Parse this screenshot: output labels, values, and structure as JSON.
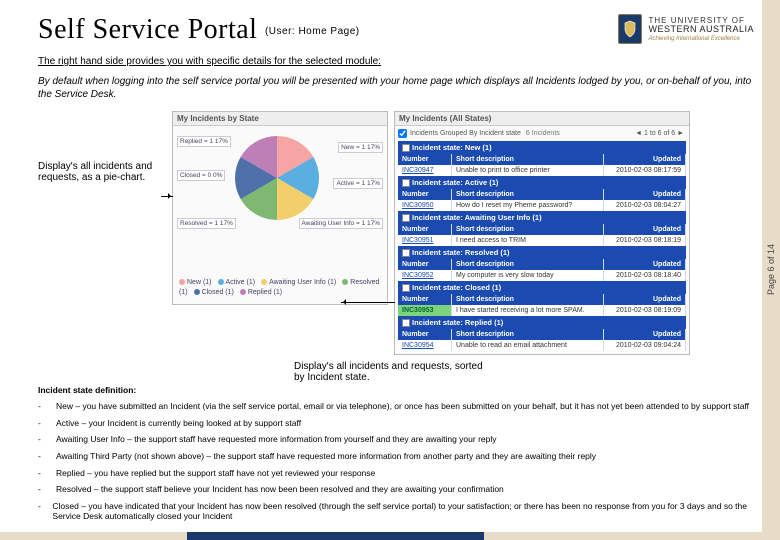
{
  "page_counter": "Page 6 of 14",
  "title_main": "Self Service Portal",
  "title_sub": "(User: Home Page)",
  "uwa": {
    "line1": "THE UNIVERSITY OF",
    "line2": "WESTERN AUSTRALIA",
    "line3": "Achieving International Excellence"
  },
  "intro_underlined": "The right hand side provides you with specific details for the selected module:",
  "intro_italic": "By default when logging into the self service portal you will be presented with your home page which displays all Incidents lodged by you, or on-behalf of you, into the Service Desk.",
  "callout_pie": "Display's all incidents and requests, as a pie-chart.",
  "callout_list": "Display's all incidents and requests, sorted by Incident state.",
  "panel_left_title": "My Incidents by State",
  "panel_right_title": "My Incidents (All States)",
  "grouped_text": "Incidents Grouped By Incident state",
  "grouped_count": "6 Incidents",
  "pager_text": "1 to 6 of 6",
  "col_number": "Number",
  "col_desc": "Short description",
  "col_updated": "Updated",
  "pie": {
    "labels": {
      "replied": "Replied = 1\n17%",
      "closed": "Closed = 0\n0%",
      "resolved": "Resolved = 1\n17%",
      "new": "New = 1 17%",
      "active": "Active = 1 17%",
      "awaiting": "Awaiting User\nInfo = 1 17%"
    },
    "legend": [
      {
        "label": "New (1)",
        "color": "#f6a4a4"
      },
      {
        "label": "Active (1)",
        "color": "#5aaee0"
      },
      {
        "label": "Awaiting User Info (1)",
        "color": "#f3cf6b"
      },
      {
        "label": "Resolved (1)",
        "color": "#7fb971"
      },
      {
        "label": "Closed (1)",
        "color": "#4e6fa7"
      },
      {
        "label": "Replied (1)",
        "color": "#bd7fb5"
      }
    ]
  },
  "states": [
    {
      "state": "Incident state: New (1)",
      "rows": [
        {
          "num": "INC30947",
          "desc": "Unable to print to office printer",
          "upd": "2010-02-03 08:17:59"
        }
      ]
    },
    {
      "state": "Incident state: Active (1)",
      "rows": [
        {
          "num": "INC30950",
          "desc": "How do I reset my Pheme password?",
          "upd": "2010-02-03 08:04:27"
        }
      ]
    },
    {
      "state": "Incident state: Awaiting User Info (1)",
      "rows": [
        {
          "num": "INC30951",
          "desc": "I need access to TRIM",
          "upd": "2010-02-03 08:18:19"
        }
      ]
    },
    {
      "state": "Incident state: Resolved (1)",
      "rows": [
        {
          "num": "INC30952",
          "desc": "My computer is very slow today",
          "upd": "2010-02-03 08:18:40"
        }
      ]
    },
    {
      "state": "Incident state: Closed (1)",
      "rows": [
        {
          "num": "INC30953",
          "desc": "I have started receiving a lot more SPAM.",
          "upd": "2010-02-03 08:19:09",
          "green": true
        }
      ]
    },
    {
      "state": "Incident state: Replied (1)",
      "rows": [
        {
          "num": "INC30954",
          "desc": "Unable to read an email attachment",
          "upd": "2010-02-03 09:04:24"
        }
      ]
    }
  ],
  "defs_title": "Incident state definition:",
  "defs": [
    "New – you have submitted an Incident (via the self service portal, email or via telephone), or once has been submitted on your behalf, but it has not yet been attended to by support staff",
    "Active – your Incident is currently being looked at by support staff",
    "Awaiting User Info – the support staff have requested more information from yourself and they are awaiting your reply",
    "Awaiting Third Party (not shown above) – the support staff have requested more information from another party and they are awaiting their reply",
    "Replied – you have replied but the support staff have not yet reviewed your response",
    "Resolved – the support staff believe your Incident has now been been resolved and they are awaiting your confirmation",
    "Closed – you have indicated that your Incident has now been resolved (through the self service portal) to your satisfaction; or there has been no response from you for 3 days and so the Service Desk automatically closed your Incident"
  ]
}
